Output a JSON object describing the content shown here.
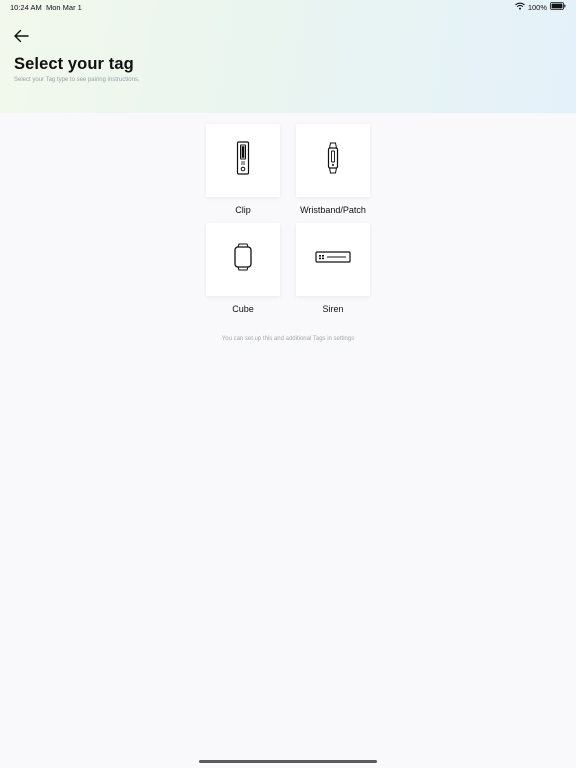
{
  "status_bar": {
    "time": "10:24 AM",
    "date": "Mon Mar 1",
    "battery": "100%"
  },
  "header": {
    "back_icon": "arrow-left-icon",
    "title": "Select your tag",
    "subtitle": "Select your Tag type to see pairing instructions."
  },
  "tags": [
    {
      "label": "Clip",
      "icon": "clip-tag-icon"
    },
    {
      "label": "Wristband/Patch",
      "icon": "wristband-tag-icon"
    },
    {
      "label": "Cube",
      "icon": "cube-tag-icon"
    },
    {
      "label": "Siren",
      "icon": "siren-tag-icon"
    }
  ],
  "footer_note": "You can set up this and additional Tags in settings",
  "colors": {
    "header_gradient_start": "#f2f8ec",
    "header_gradient_end": "#e4f1fa",
    "background": "#f9f9fb",
    "tile": "#ffffff",
    "text": "#111111",
    "muted_text": "#9aa0a6"
  }
}
